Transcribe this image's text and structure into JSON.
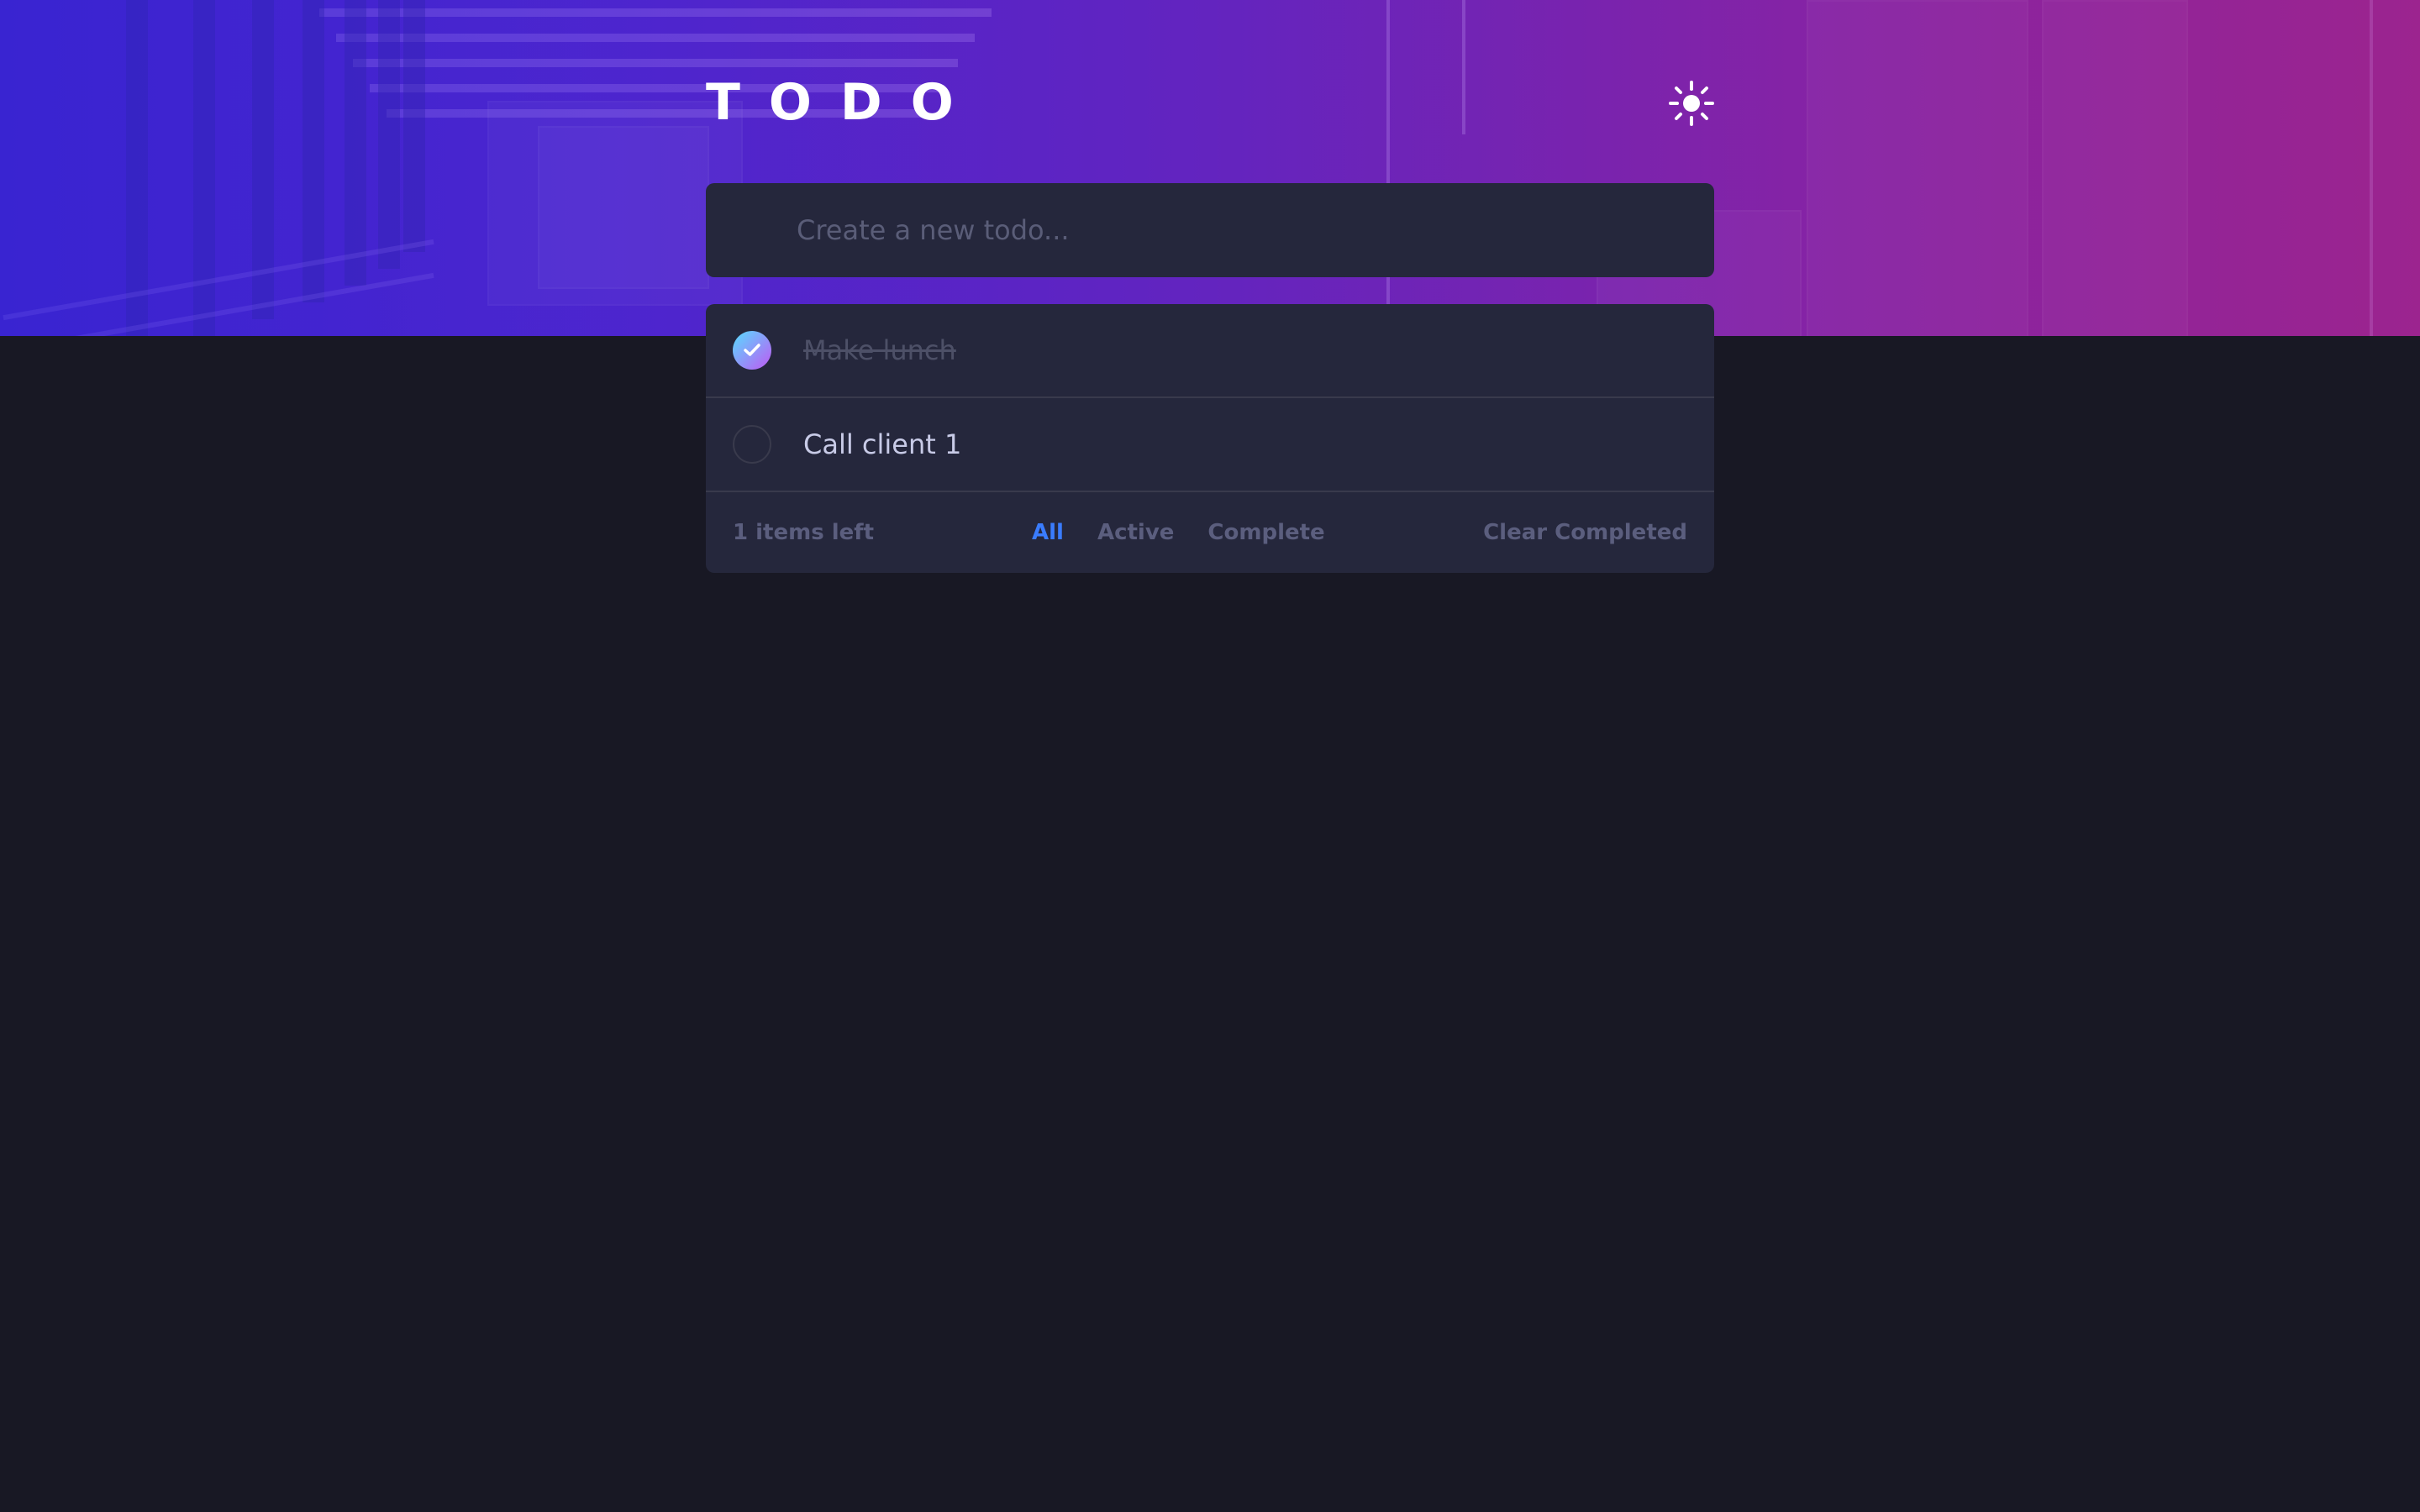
{
  "app": {
    "title": "TODO",
    "theme_toggle_icon": "sun-icon"
  },
  "new_todo": {
    "placeholder": "Create a new todo..."
  },
  "todos": [
    {
      "text": "Make lunch",
      "completed": true
    },
    {
      "text": "Call client 1",
      "completed": false
    }
  ],
  "footer": {
    "items_left": "1 items left",
    "filters": [
      {
        "label": "All",
        "active": true
      },
      {
        "label": "Active",
        "active": false
      },
      {
        "label": "Complete",
        "active": false
      }
    ],
    "clear_completed": "Clear Completed"
  },
  "colors": {
    "background": "#181824",
    "card": "#25273c",
    "accent": "#3a7cfd",
    "check_gradient_start": "#57ddff",
    "check_gradient_end": "#c058f3"
  }
}
